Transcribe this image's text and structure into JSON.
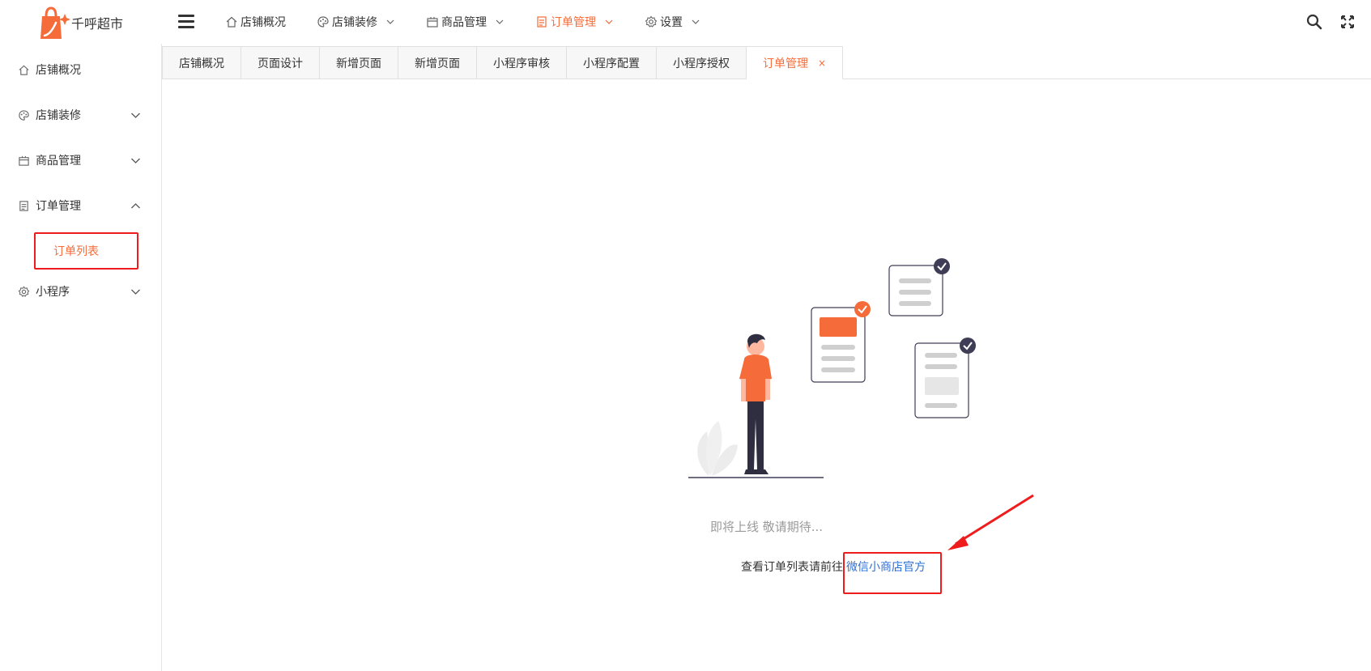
{
  "app": {
    "name": "千呼超市"
  },
  "colors": {
    "accent": "#f56c3a",
    "highlight": "#ee1c1c",
    "link": "#2e6fd6"
  },
  "topnav": {
    "items": [
      {
        "label": "店铺概况",
        "icon": "home-icon"
      },
      {
        "label": "店铺装修",
        "icon": "palette-icon"
      },
      {
        "label": "商品管理",
        "icon": "box-icon"
      },
      {
        "label": "订单管理",
        "icon": "clipboard-icon",
        "active": true
      },
      {
        "label": "设置",
        "icon": "gear-icon"
      }
    ]
  },
  "sidebar": {
    "items": [
      {
        "label": "店铺概况",
        "icon": "home-icon"
      },
      {
        "label": "店铺装修",
        "icon": "palette-icon"
      },
      {
        "label": "商品管理",
        "icon": "box-icon"
      },
      {
        "label": "订单管理",
        "icon": "clipboard-icon",
        "expanded": true
      },
      {
        "label": "小程序",
        "icon": "gear-icon"
      }
    ],
    "sub_item": "订单列表"
  },
  "tabs": [
    {
      "label": "店铺概况"
    },
    {
      "label": "页面设计"
    },
    {
      "label": "新增页面"
    },
    {
      "label": "新增页面"
    },
    {
      "label": "小程序审核"
    },
    {
      "label": "小程序配置"
    },
    {
      "label": "小程序授权"
    },
    {
      "label": "订单管理",
      "active": true,
      "close": "×"
    }
  ],
  "content": {
    "coming_soon": "即将上线 敬请期待...",
    "goto_text": "查看订单列表请前往",
    "goto_link": "微信小商店官方"
  }
}
